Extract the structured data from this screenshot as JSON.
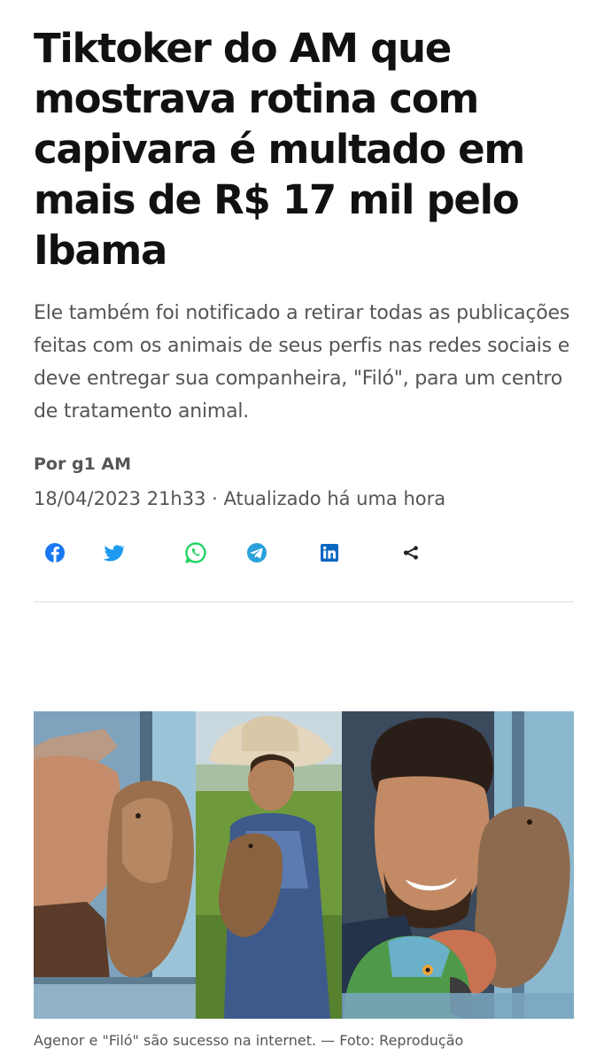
{
  "article": {
    "headline": "Tiktoker do AM que mostrava rotina com capivara é multado em mais de R$ 17 mil pelo Ibama",
    "subtitle": "Ele também foi notificado a retirar todas as publicações feitas com os animais de seus perfis nas redes sociais e deve entregar sua companheira, \"Filó\", para um centro de tratamento animal.",
    "byline": "Por g1 AM",
    "dateline": "18/04/2023 21h33 · Atualizado há uma hora",
    "photo_caption": "Agenor e \"Filó\" são sucesso na internet. — Foto: Reprodução"
  },
  "share": {
    "buttons": [
      {
        "icon": "facebook-icon",
        "color": "#1877f2"
      },
      {
        "icon": "twitter-icon",
        "color": "#1d9bf0"
      },
      {
        "icon": "whatsapp-icon",
        "color": "#25d366"
      },
      {
        "icon": "telegram-icon",
        "color": "#2aa1da"
      },
      {
        "icon": "linkedin-icon",
        "color": "#0a66c2"
      },
      {
        "icon": "share-icon",
        "color": "#222222"
      }
    ]
  }
}
